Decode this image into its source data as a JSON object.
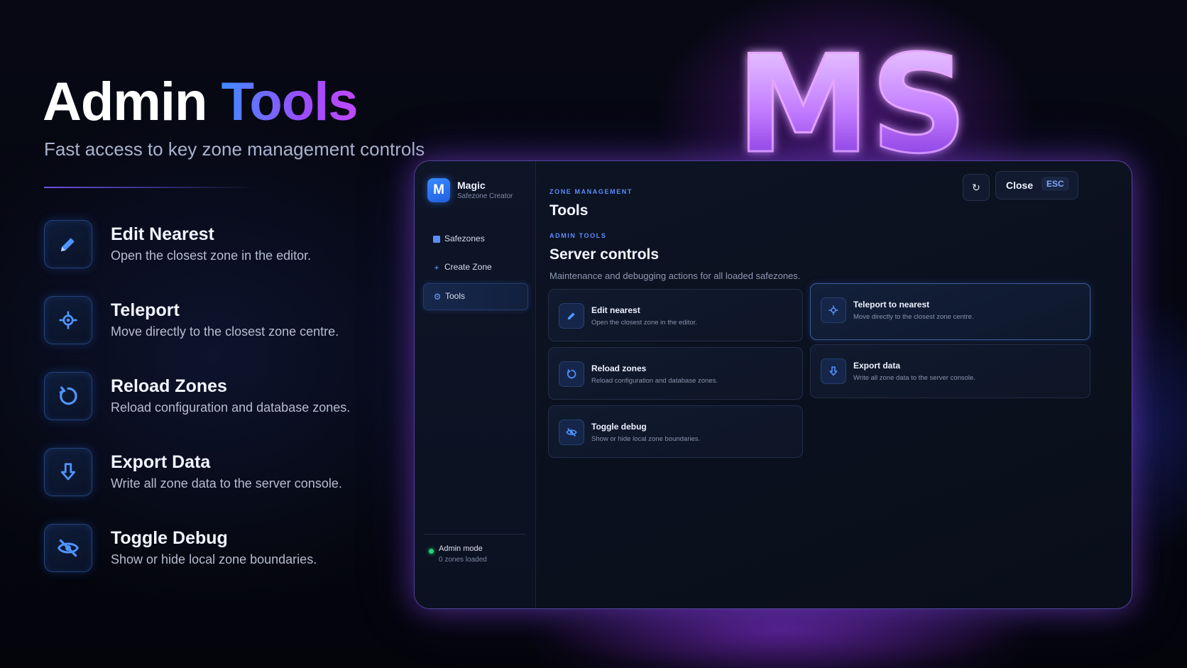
{
  "hero": {
    "title_word1": "Admin",
    "title_word2": "Tools",
    "subtitle": "Fast access to key zone management controls"
  },
  "features": [
    {
      "icon": "pencil-icon",
      "title": "Edit Nearest",
      "description": "Open the closest zone in the editor."
    },
    {
      "icon": "crosshair-icon",
      "title": "Teleport",
      "description": "Move directly to the closest zone centre."
    },
    {
      "icon": "reload-icon",
      "title": "Reload Zones",
      "description": "Reload configuration and database zones."
    },
    {
      "icon": "download-arrow-icon",
      "title": "Export Data",
      "description": "Write all zone data to the server console."
    },
    {
      "icon": "eye-off-icon",
      "title": "Toggle Debug",
      "description": "Show or hide local zone boundaries."
    }
  ],
  "logo": {
    "text": "MS"
  },
  "app": {
    "brand_letter": "M",
    "brand_name": "Magic",
    "brand_subtitle": "Safezone Creator",
    "nav": [
      {
        "icon": "grid-icon",
        "label": "Safezones",
        "active": false
      },
      {
        "icon": "plus-icon",
        "label": "Create Zone",
        "active": false
      },
      {
        "icon": "gear-icon",
        "label": "Tools",
        "active": true
      }
    ],
    "status": {
      "label": "Admin mode",
      "detail": "0 zones loaded",
      "color": "#22d37a"
    },
    "header": {
      "eyebrow": "ZONE MANAGEMENT",
      "title": "Tools",
      "refresh_icon": "refresh-icon",
      "close_label": "Close",
      "close_key": "ESC"
    },
    "section": {
      "eyebrow": "ADMIN TOOLS",
      "title": "Server controls",
      "description": "Maintenance and debugging actions for all loaded safezones."
    },
    "actions": [
      {
        "icon": "pencil-icon",
        "title": "Edit nearest",
        "description": "Open the closest zone in the editor."
      },
      {
        "icon": "crosshair-icon",
        "title": "Teleport to nearest",
        "description": "Move directly to the closest zone centre."
      },
      {
        "icon": "reload-icon",
        "title": "Reload zones",
        "description": "Reload configuration and database zones."
      },
      {
        "icon": "download-arrow-icon",
        "title": "Export data",
        "description": "Write all zone data to the server console."
      },
      {
        "icon": "eye-off-icon",
        "title": "Toggle debug",
        "description": "Show or hide local zone boundaries."
      }
    ]
  },
  "colors": {
    "accent_blue": "#3f8bff",
    "accent_purple": "#9b4dff",
    "status_green": "#22d37a"
  }
}
